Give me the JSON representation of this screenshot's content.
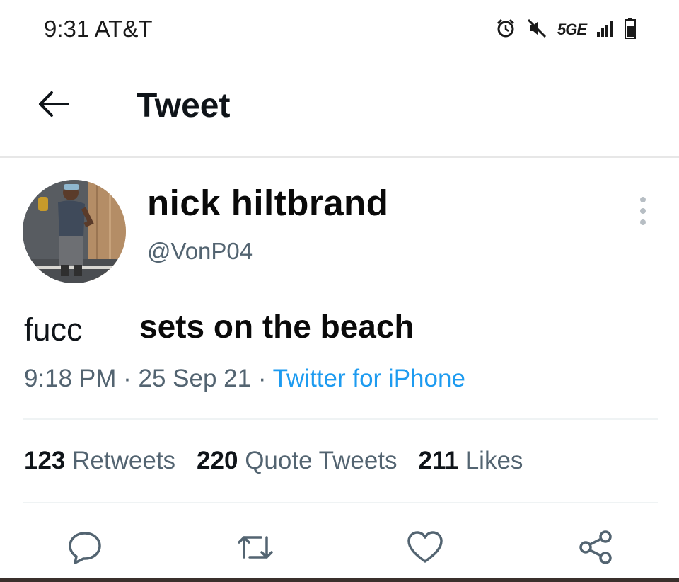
{
  "status_bar": {
    "time": "9:31",
    "carrier": "AT&T",
    "network": "5GE",
    "icons": [
      "alarm-icon",
      "mute-icon",
      "signal-icon",
      "battery-icon"
    ]
  },
  "header": {
    "title": "Tweet",
    "back_icon": "back-arrow-icon"
  },
  "tweet": {
    "author": {
      "display_name": "nick hiltbrand",
      "handle": "@VonP04"
    },
    "text_part1": "fucc",
    "text_part2": "sets on the beach",
    "time": "9:18 PM",
    "separator": "·",
    "date": "25 Sep 21",
    "source": "Twitter for iPhone",
    "stats": {
      "retweets_count": "123",
      "retweets_label": "Retweets",
      "quotes_count": "220",
      "quotes_label": "Quote Tweets",
      "likes_count": "211",
      "likes_label": "Likes"
    },
    "actions": [
      "reply-icon",
      "retweet-icon",
      "like-icon",
      "share-icon"
    ]
  },
  "colors": {
    "text_primary": "#0f1419",
    "text_secondary": "#536471",
    "link": "#1d9bf0",
    "divider": "#eff3f4"
  }
}
